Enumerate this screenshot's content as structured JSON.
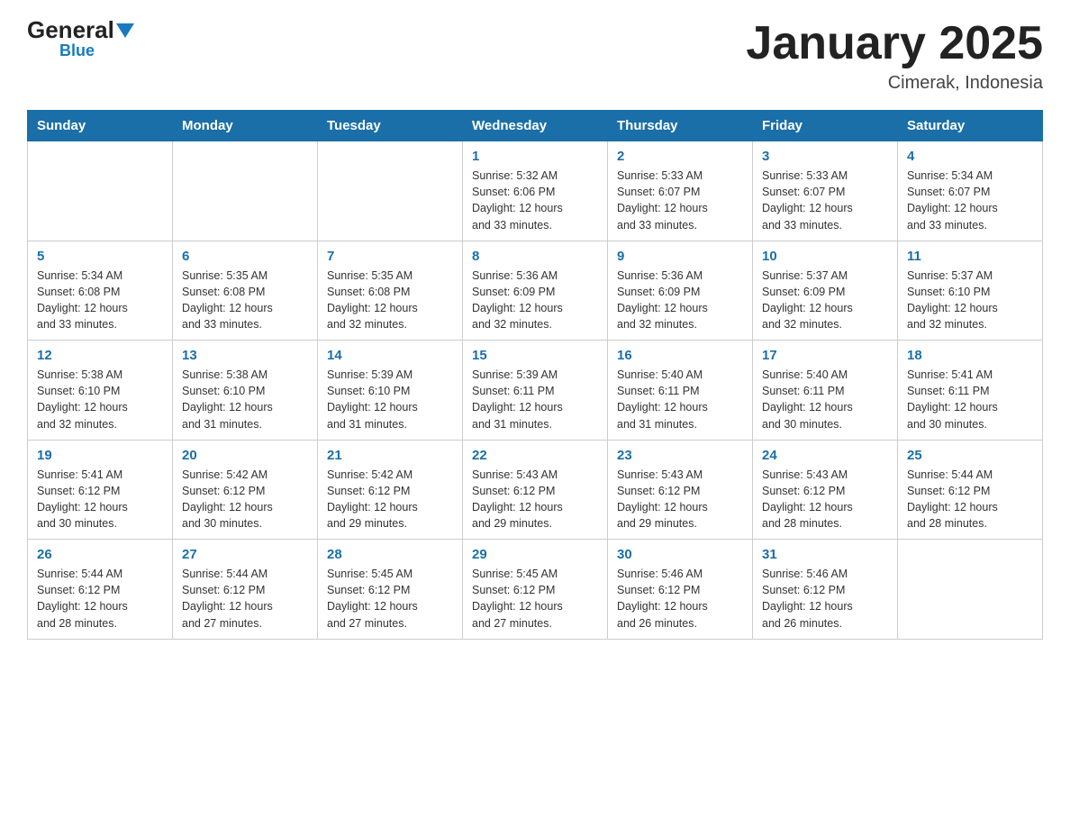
{
  "logo": {
    "general": "General",
    "blue": "Blue"
  },
  "title": "January 2025",
  "location": "Cimerak, Indonesia",
  "days_of_week": [
    "Sunday",
    "Monday",
    "Tuesday",
    "Wednesday",
    "Thursday",
    "Friday",
    "Saturday"
  ],
  "weeks": [
    [
      {
        "day": "",
        "info": ""
      },
      {
        "day": "",
        "info": ""
      },
      {
        "day": "",
        "info": ""
      },
      {
        "day": "1",
        "info": "Sunrise: 5:32 AM\nSunset: 6:06 PM\nDaylight: 12 hours\nand 33 minutes."
      },
      {
        "day": "2",
        "info": "Sunrise: 5:33 AM\nSunset: 6:07 PM\nDaylight: 12 hours\nand 33 minutes."
      },
      {
        "day": "3",
        "info": "Sunrise: 5:33 AM\nSunset: 6:07 PM\nDaylight: 12 hours\nand 33 minutes."
      },
      {
        "day": "4",
        "info": "Sunrise: 5:34 AM\nSunset: 6:07 PM\nDaylight: 12 hours\nand 33 minutes."
      }
    ],
    [
      {
        "day": "5",
        "info": "Sunrise: 5:34 AM\nSunset: 6:08 PM\nDaylight: 12 hours\nand 33 minutes."
      },
      {
        "day": "6",
        "info": "Sunrise: 5:35 AM\nSunset: 6:08 PM\nDaylight: 12 hours\nand 33 minutes."
      },
      {
        "day": "7",
        "info": "Sunrise: 5:35 AM\nSunset: 6:08 PM\nDaylight: 12 hours\nand 32 minutes."
      },
      {
        "day": "8",
        "info": "Sunrise: 5:36 AM\nSunset: 6:09 PM\nDaylight: 12 hours\nand 32 minutes."
      },
      {
        "day": "9",
        "info": "Sunrise: 5:36 AM\nSunset: 6:09 PM\nDaylight: 12 hours\nand 32 minutes."
      },
      {
        "day": "10",
        "info": "Sunrise: 5:37 AM\nSunset: 6:09 PM\nDaylight: 12 hours\nand 32 minutes."
      },
      {
        "day": "11",
        "info": "Sunrise: 5:37 AM\nSunset: 6:10 PM\nDaylight: 12 hours\nand 32 minutes."
      }
    ],
    [
      {
        "day": "12",
        "info": "Sunrise: 5:38 AM\nSunset: 6:10 PM\nDaylight: 12 hours\nand 32 minutes."
      },
      {
        "day": "13",
        "info": "Sunrise: 5:38 AM\nSunset: 6:10 PM\nDaylight: 12 hours\nand 31 minutes."
      },
      {
        "day": "14",
        "info": "Sunrise: 5:39 AM\nSunset: 6:10 PM\nDaylight: 12 hours\nand 31 minutes."
      },
      {
        "day": "15",
        "info": "Sunrise: 5:39 AM\nSunset: 6:11 PM\nDaylight: 12 hours\nand 31 minutes."
      },
      {
        "day": "16",
        "info": "Sunrise: 5:40 AM\nSunset: 6:11 PM\nDaylight: 12 hours\nand 31 minutes."
      },
      {
        "day": "17",
        "info": "Sunrise: 5:40 AM\nSunset: 6:11 PM\nDaylight: 12 hours\nand 30 minutes."
      },
      {
        "day": "18",
        "info": "Sunrise: 5:41 AM\nSunset: 6:11 PM\nDaylight: 12 hours\nand 30 minutes."
      }
    ],
    [
      {
        "day": "19",
        "info": "Sunrise: 5:41 AM\nSunset: 6:12 PM\nDaylight: 12 hours\nand 30 minutes."
      },
      {
        "day": "20",
        "info": "Sunrise: 5:42 AM\nSunset: 6:12 PM\nDaylight: 12 hours\nand 30 minutes."
      },
      {
        "day": "21",
        "info": "Sunrise: 5:42 AM\nSunset: 6:12 PM\nDaylight: 12 hours\nand 29 minutes."
      },
      {
        "day": "22",
        "info": "Sunrise: 5:43 AM\nSunset: 6:12 PM\nDaylight: 12 hours\nand 29 minutes."
      },
      {
        "day": "23",
        "info": "Sunrise: 5:43 AM\nSunset: 6:12 PM\nDaylight: 12 hours\nand 29 minutes."
      },
      {
        "day": "24",
        "info": "Sunrise: 5:43 AM\nSunset: 6:12 PM\nDaylight: 12 hours\nand 28 minutes."
      },
      {
        "day": "25",
        "info": "Sunrise: 5:44 AM\nSunset: 6:12 PM\nDaylight: 12 hours\nand 28 minutes."
      }
    ],
    [
      {
        "day": "26",
        "info": "Sunrise: 5:44 AM\nSunset: 6:12 PM\nDaylight: 12 hours\nand 28 minutes."
      },
      {
        "day": "27",
        "info": "Sunrise: 5:44 AM\nSunset: 6:12 PM\nDaylight: 12 hours\nand 27 minutes."
      },
      {
        "day": "28",
        "info": "Sunrise: 5:45 AM\nSunset: 6:12 PM\nDaylight: 12 hours\nand 27 minutes."
      },
      {
        "day": "29",
        "info": "Sunrise: 5:45 AM\nSunset: 6:12 PM\nDaylight: 12 hours\nand 27 minutes."
      },
      {
        "day": "30",
        "info": "Sunrise: 5:46 AM\nSunset: 6:12 PM\nDaylight: 12 hours\nand 26 minutes."
      },
      {
        "day": "31",
        "info": "Sunrise: 5:46 AM\nSunset: 6:12 PM\nDaylight: 12 hours\nand 26 minutes."
      },
      {
        "day": "",
        "info": ""
      }
    ]
  ]
}
